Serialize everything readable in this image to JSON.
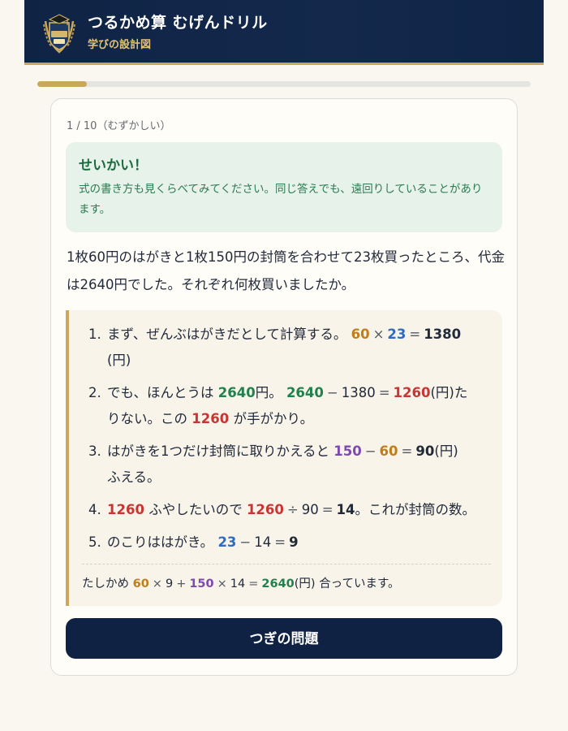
{
  "header": {
    "title": "つるかめ算 むげんドリル",
    "subtitle": "学びの設計図",
    "logo_icon": "graduation-crest-icon",
    "colors": {
      "bg": "#13284b",
      "accent": "#c9a85c"
    }
  },
  "progress": {
    "fraction": 0.1
  },
  "counter": "1 / 10（むずかしい）",
  "feedback": {
    "title": "せいかい！",
    "message": "式の書き方も見くらべてみてください。同じ答えでも、遠回りしていることがあります。"
  },
  "question": "1枚60円のはがきと1枚150円の封筒を合わせて23枚買ったところ、代金は2640円でした。それぞれ何枚買いましたか。",
  "steps": [
    {
      "num": "1.",
      "text1": "まず、ぜんぶはがきだとして計算する。",
      "a": "60",
      "op1": "×",
      "b": "23",
      "eq": "=",
      "result": "1380",
      "cont": "(円)"
    },
    {
      "num": "2.",
      "text1": "でも、ほんとうは",
      "actual": "2640",
      "unit1": "円。",
      "a": "2640",
      "op1": "−",
      "b": "1380",
      "eq": "=",
      "result": "1260",
      "unit2": "(円)た",
      "cont": "りない。この",
      "key": "1260",
      "cont2": "が手がかり。"
    },
    {
      "num": "3.",
      "text1": "はがきを1つだけ封筒に取りかえると",
      "a": "150",
      "op1": "−",
      "b": "60",
      "eq": "=",
      "result": "90",
      "unit": "(円)",
      "cont": "ふえる。"
    },
    {
      "num": "4.",
      "lead": "1260",
      "text1": "ふやしたいので",
      "a": "1260",
      "op1": "÷",
      "b": "90",
      "eq": "=",
      "result": "14",
      "text2": "。これが封筒の数。"
    },
    {
      "num": "5.",
      "text1": "のこりははがき。",
      "a": "23",
      "op1": "−",
      "b": "14",
      "eq": "=",
      "result": "9"
    }
  ],
  "check": {
    "label": "たしかめ",
    "p1": "60",
    "op1": "×",
    "n1": "9",
    "plus": "+",
    "p2": "150",
    "op2": "×",
    "n2": "14",
    "eq": "=",
    "total": "2640",
    "unit": "(円)",
    "suffix": "合っています。"
  },
  "next_button": "つぎの問題"
}
